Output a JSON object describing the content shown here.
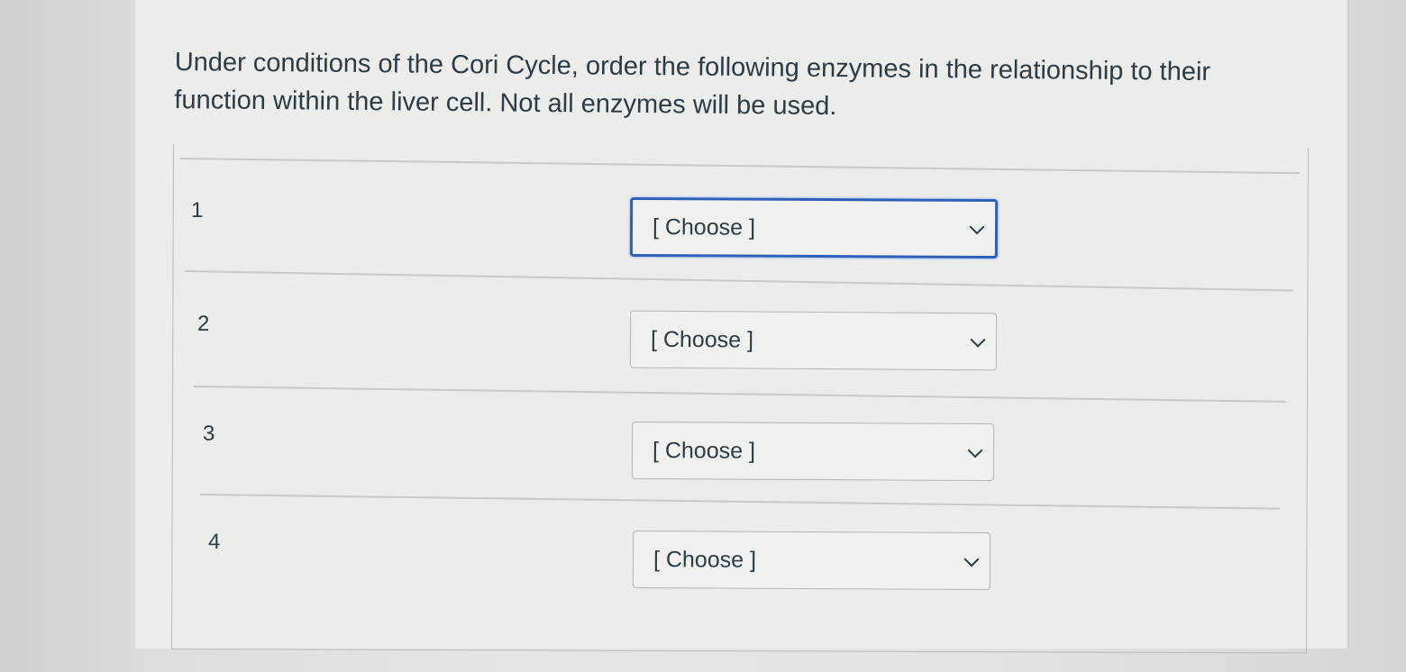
{
  "question": {
    "prompt": "Under conditions of the Cori Cycle, order the following enzymes in the relationship to their function within the liver cell. Not all enzymes will be used."
  },
  "rows": [
    {
      "number": "1",
      "selected": "[ Choose ]"
    },
    {
      "number": "2",
      "selected": "[ Choose ]"
    },
    {
      "number": "3",
      "selected": "[ Choose ]"
    },
    {
      "number": "4",
      "selected": "[ Choose ]"
    }
  ],
  "icons": {
    "dropdown": "chevron-down-icon"
  },
  "colors": {
    "text": "#2d3b45",
    "focus_border": "#2b5fb8",
    "border": "#b3b3b1"
  }
}
